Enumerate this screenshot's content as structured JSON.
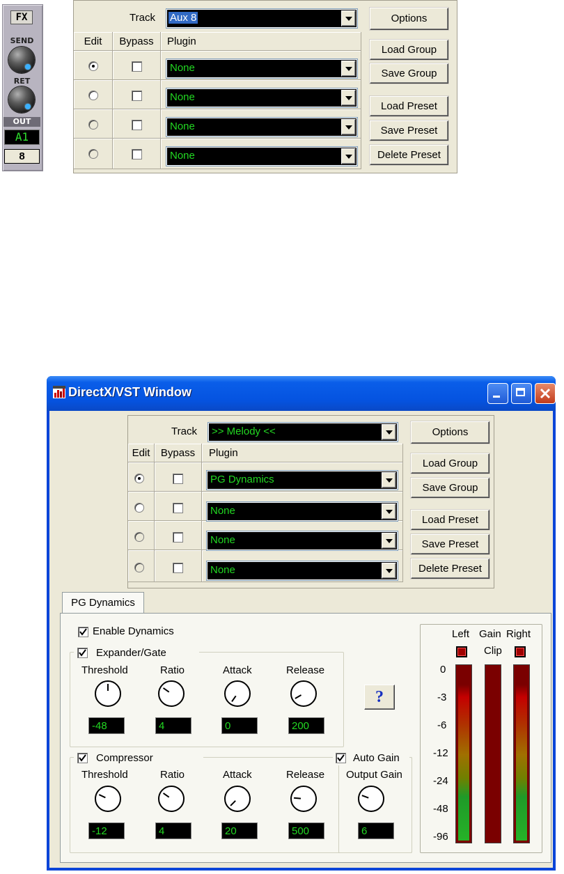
{
  "fx_strip": {
    "fx_label": "FX",
    "send_label": "SEND",
    "ret_label": "RET",
    "out_label": "OUT",
    "out_value": "A1",
    "channel": "8"
  },
  "top_panel": {
    "track_label": "Track",
    "track_value": "Aux 8",
    "headers": {
      "edit": "Edit",
      "bypass": "Bypass",
      "plugin": "Plugin"
    },
    "rows": [
      {
        "edit_selected": true,
        "plugin": "None"
      },
      {
        "edit_selected": false,
        "plugin": "None"
      },
      {
        "edit_selected": false,
        "plugin": "None"
      },
      {
        "edit_selected": false,
        "plugin": "None"
      }
    ],
    "buttons": {
      "options": "Options",
      "load_group": "Load Group",
      "save_group": "Save Group",
      "load_preset": "Load Preset",
      "save_preset": "Save Preset",
      "delete_preset": "Delete Preset"
    }
  },
  "window": {
    "title": "DirectX/VST Window",
    "panel": {
      "track_label": "Track",
      "track_value": ">> Melody <<",
      "headers": {
        "edit": "Edit",
        "bypass": "Bypass",
        "plugin": "Plugin"
      },
      "rows": [
        {
          "edit_selected": true,
          "plugin": "PG Dynamics"
        },
        {
          "edit_selected": false,
          "plugin": "None"
        },
        {
          "edit_selected": false,
          "plugin": "None"
        },
        {
          "edit_selected": false,
          "plugin": "None"
        }
      ],
      "buttons": {
        "options": "Options",
        "load_group": "Load Group",
        "save_group": "Save Group",
        "load_preset": "Load Preset",
        "save_preset": "Save Preset",
        "delete_preset": "Delete Preset"
      }
    },
    "tab_label": "PG Dynamics",
    "enable_dynamics": "Enable Dynamics",
    "expander": {
      "title": "Expander/Gate",
      "threshold_label": "Threshold",
      "threshold": "-48",
      "ratio_label": "Ratio",
      "ratio": "4",
      "attack_label": "Attack",
      "attack": "0",
      "release_label": "Release",
      "release": "200"
    },
    "compressor": {
      "title": "Compressor",
      "threshold_label": "Threshold",
      "threshold": "-12",
      "ratio_label": "Ratio",
      "ratio": "4",
      "attack_label": "Attack",
      "attack": "20",
      "release_label": "Release",
      "release": "500"
    },
    "auto_gain": "Auto Gain",
    "output_gain_label": "Output Gain",
    "output_gain": "6",
    "help_glyph": "?",
    "meters": {
      "left_label": "Left",
      "gain_label": "Gain",
      "right_label": "Right",
      "clip_label": "Clip",
      "scale": [
        "0",
        "-3",
        "-6",
        "-12",
        "-24",
        "-48",
        "-96"
      ]
    }
  }
}
